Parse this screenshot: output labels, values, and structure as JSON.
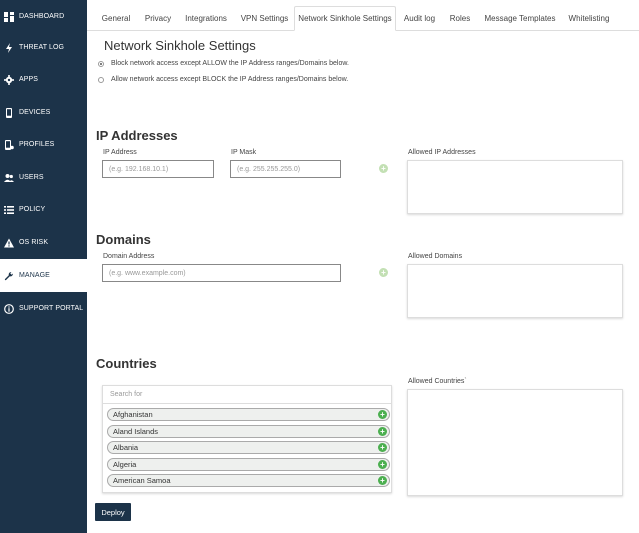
{
  "sidebar": {
    "items": [
      {
        "label": "DASHBOARD",
        "icon": "dashboard-icon"
      },
      {
        "label": "THREAT LOG",
        "icon": "lightning-icon"
      },
      {
        "label": "APPS",
        "icon": "gear-icon"
      },
      {
        "label": "DEVICES",
        "icon": "phone-icon"
      },
      {
        "label": "PROFILES",
        "icon": "profile-phone-icon"
      },
      {
        "label": "USERS",
        "icon": "users-icon"
      },
      {
        "label": "POLICY",
        "icon": "list-icon"
      },
      {
        "label": "OS RISK",
        "icon": "warning-icon"
      },
      {
        "label": "MANAGE",
        "icon": "wrench-icon",
        "active": true
      },
      {
        "label": "SUPPORT PORTAL",
        "icon": "info-icon"
      }
    ]
  },
  "tabs": [
    {
      "label": "General"
    },
    {
      "label": "Privacy"
    },
    {
      "label": "Integrations"
    },
    {
      "label": "VPN Settings"
    },
    {
      "label": "Network Sinkhole Settings",
      "active": true
    },
    {
      "label": "Audit log"
    },
    {
      "label": "Roles"
    },
    {
      "label": "Message Templates"
    },
    {
      "label": "Whitelisting"
    }
  ],
  "page": {
    "title": "Network Sinkhole Settings",
    "radio_allow": "Block network access except ALLOW the IP Address ranges/Domains below.",
    "radio_block": "Allow network access except BLOCK the IP Address ranges/Domains below."
  },
  "ip": {
    "section_title": "IP Addresses",
    "address_label": "IP Address",
    "address_placeholder": "(e.g. 192.168.10.1)",
    "mask_label": "IP Mask",
    "mask_placeholder": "(e.g. 255.255.255.0)",
    "allowed_label": "Allowed IP Addresses"
  },
  "domains": {
    "section_title": "Domains",
    "address_label": "Domain Address",
    "address_placeholder": "(e.g. www.example.com)",
    "allowed_label": "Allowed Domains"
  },
  "countries": {
    "section_title": "Countries",
    "search_placeholder": "Search for",
    "allowed_label": "Allowed Countries`",
    "items": [
      "Afghanistan",
      "Aland Islands",
      "Albania",
      "Algeria",
      "American Samoa"
    ]
  },
  "deploy_label": "Deploy",
  "colors": {
    "sidebar": "#1c3349",
    "add_green": "#4caf50"
  }
}
